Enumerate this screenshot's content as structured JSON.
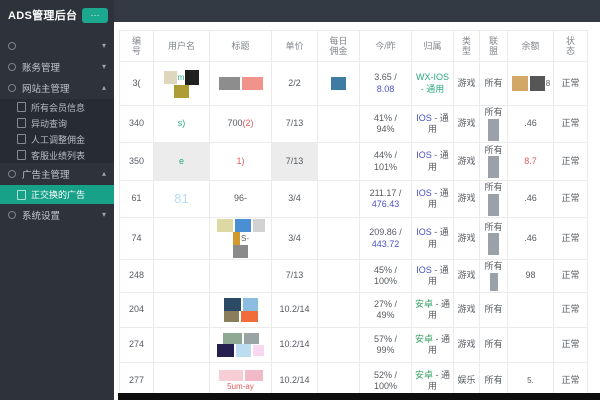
{
  "app": {
    "title": "ADS管理后台",
    "menu_button": "···"
  },
  "colors": {
    "accent_teal": "#1ba88e",
    "active_item": "#17a189",
    "link_blue": "#4b50c8",
    "green": "#2f9e5f",
    "teal_text": "#2aa87e",
    "red": "#e25a5a",
    "sidebar_bg": "#2d323b",
    "topbar_bg": "#343a44"
  },
  "sidebar": {
    "items": [
      {
        "type": "parent",
        "label": "",
        "caret": "down"
      },
      {
        "type": "parent",
        "label": "账务管理",
        "caret": "down"
      },
      {
        "type": "parent",
        "label": "网站主管理",
        "caret": "up"
      },
      {
        "type": "child",
        "label": "所有会员信息"
      },
      {
        "type": "child",
        "label": "异动查询"
      },
      {
        "type": "child",
        "label": "人工调整佣金"
      },
      {
        "type": "child",
        "label": "客服业绩列表"
      },
      {
        "type": "parent",
        "label": "广告主管理",
        "caret": "up"
      },
      {
        "type": "child",
        "label": "正交换的广告",
        "active": true
      },
      {
        "type": "parent",
        "label": "系统设置",
        "caret": "down"
      }
    ]
  },
  "table": {
    "columns": [
      {
        "label": "编\n号",
        "w": 34
      },
      {
        "label": "用户名",
        "w": 56
      },
      {
        "label": "标题",
        "w": 62
      },
      {
        "label": "单价",
        "w": 46
      },
      {
        "label": "每日\n佣金",
        "w": 42
      },
      {
        "label": "今/昨",
        "w": 52
      },
      {
        "label": "归属",
        "w": 42
      },
      {
        "label": "类\n型",
        "w": 26
      },
      {
        "label": "联\n盟",
        "w": 28
      },
      {
        "label": "余额",
        "w": 46
      },
      {
        "label": "状\n态",
        "w": 34
      }
    ],
    "rows": [
      {
        "h": 44,
        "cells": [
          {
            "seq": [
              {
                "t": "3("
              }
            ]
          },
          {
            "seq": [
              {
                "b": "#ded7bd",
                "w": 13,
                "h": 13
              },
              {
                "t": "m",
                "c": "#2aa87e",
                "s": 8
              },
              {
                "b": "#20201e",
                "w": 14,
                "h": 15
              },
              {
                "b": "#ac9e35",
                "w": 15,
                "h": 13
              }
            ]
          },
          {
            "seq": [
              {
                "b": "#8d8d8d",
                "w": 21,
                "h": 13
              },
              {
                "b": "#f0938a",
                "w": 21,
                "h": 13
              }
            ]
          },
          {
            "seq": [
              {
                "t": "2/2"
              }
            ]
          },
          {
            "seq": [
              {
                "b": "#3e7ca3",
                "w": 15,
                "h": 13
              }
            ]
          },
          {
            "seq": [
              {
                "t": "3.65 /"
              },
              {
                "br": true
              },
              {
                "t": "8.08",
                "c": "#4b50c8"
              }
            ]
          },
          {
            "seq": [
              {
                "t": "WX-IOS - 通用",
                "c": "#2aa87e"
              }
            ]
          },
          {
            "seq": [
              {
                "t": "游戏"
              }
            ]
          },
          {
            "seq": [
              {
                "t": "所有"
              }
            ]
          },
          {
            "seq": [
              {
                "b": "#d2a768",
                "w": 16,
                "h": 15
              },
              {
                "b": "#565656",
                "w": 15,
                "h": 15
              },
              {
                "t": "8",
                "s": 8
              }
            ]
          },
          {
            "seq": [
              {
                "t": "正常"
              }
            ]
          }
        ]
      },
      {
        "h": 37,
        "cells": [
          {
            "seq": [
              {
                "t": "340"
              }
            ]
          },
          {
            "seq": [
              {
                "t": "s)",
                "c": "#2aa87e"
              }
            ]
          },
          {
            "seq": [
              {
                "t": "700"
              },
              {
                "t": "(2)",
                "c": "#e25a5a"
              }
            ]
          },
          {
            "seq": [
              {
                "t": "7/13"
              }
            ]
          },
          {
            "seq": []
          },
          {
            "seq": [
              {
                "t": "41% /"
              },
              {
                "br": true
              },
              {
                "t": "94%"
              }
            ]
          },
          {
            "seq": [
              {
                "t": "IOS ",
                "c": "#4b50c8"
              },
              {
                "t": "- 通用"
              }
            ]
          },
          {
            "seq": [
              {
                "t": "游戏"
              }
            ]
          },
          {
            "seq": [
              {
                "t": "所有"
              },
              {
                "b": "#9aa1a9",
                "w": 11,
                "h": 22
              }
            ]
          },
          {
            "seq": [
              {
                "t": ".46"
              }
            ]
          },
          {
            "seq": [
              {
                "t": "正常"
              }
            ]
          }
        ]
      },
      {
        "h": 38,
        "cells": [
          {
            "seq": [
              {
                "t": "350"
              }
            ]
          },
          {
            "bg": "#ececec",
            "seq": [
              {
                "t": "e",
                "c": "#2aa87e"
              }
            ]
          },
          {
            "seq": [
              {
                "t": "1)",
                "c": "#e25a5a"
              }
            ]
          },
          {
            "bg": "#ececec",
            "seq": [
              {
                "t": "7/13"
              }
            ]
          },
          {
            "seq": []
          },
          {
            "seq": [
              {
                "t": "44% /"
              },
              {
                "br": true
              },
              {
                "t": "101%"
              }
            ]
          },
          {
            "seq": [
              {
                "t": "IOS ",
                "c": "#4b50c8"
              },
              {
                "t": "- 通用"
              }
            ]
          },
          {
            "seq": [
              {
                "t": "游戏"
              }
            ]
          },
          {
            "seq": [
              {
                "t": "所有"
              },
              {
                "b": "#9aa1a9",
                "w": 11,
                "h": 22
              }
            ]
          },
          {
            "seq": [
              {
                "t": "8.7",
                "c": "#e25a5a"
              }
            ]
          },
          {
            "seq": [
              {
                "t": "正常"
              }
            ]
          }
        ]
      },
      {
        "h": 37,
        "cells": [
          {
            "seq": [
              {
                "t": "61"
              }
            ]
          },
          {
            "seq": [
              {
                "t": "81",
                "c": "#b9ddf1",
                "s": 13
              }
            ]
          },
          {
            "seq": [
              {
                "t": "96-"
              }
            ]
          },
          {
            "seq": [
              {
                "t": "3/4"
              }
            ]
          },
          {
            "seq": []
          },
          {
            "seq": [
              {
                "t": "211.17 /"
              },
              {
                "br": true
              },
              {
                "t": "476.43",
                "c": "#4b50c8"
              }
            ]
          },
          {
            "seq": [
              {
                "t": "IOS ",
                "c": "#4b50c8"
              },
              {
                "t": "- 通用"
              }
            ]
          },
          {
            "seq": [
              {
                "t": "游戏"
              }
            ]
          },
          {
            "seq": [
              {
                "t": "所有"
              },
              {
                "b": "#9aa1a9",
                "w": 11,
                "h": 22
              }
            ]
          },
          {
            "seq": [
              {
                "t": ".46"
              }
            ]
          },
          {
            "seq": [
              {
                "t": "正常"
              }
            ]
          }
        ]
      },
      {
        "h": 38,
        "cells": [
          {
            "seq": [
              {
                "t": "74"
              }
            ]
          },
          {
            "seq": []
          },
          {
            "seq": [
              {
                "b": "#ded9a4",
                "w": 16,
                "h": 13
              },
              {
                "b": "#4a8fd4",
                "w": 16,
                "h": 13
              },
              {
                "b": "#d2d2d2",
                "w": 12,
                "h": 13
              },
              {
                "b": "#d1992e",
                "w": 7,
                "h": 13
              },
              {
                "t": "S-",
                "s": 8
              },
              {
                "br": true
              },
              {
                "b": "#8a8a8a",
                "w": 15,
                "h": 13
              }
            ]
          },
          {
            "seq": [
              {
                "t": "3/4"
              }
            ]
          },
          {
            "seq": []
          },
          {
            "seq": [
              {
                "t": "209.86 /"
              },
              {
                "br": true
              },
              {
                "t": "443.72",
                "c": "#4b50c8"
              }
            ]
          },
          {
            "seq": [
              {
                "t": "IOS ",
                "c": "#4b50c8"
              },
              {
                "t": "- 通用"
              }
            ]
          },
          {
            "seq": [
              {
                "t": "游戏"
              }
            ]
          },
          {
            "seq": [
              {
                "t": "所有"
              },
              {
                "b": "#9aa1a9",
                "w": 11,
                "h": 22
              }
            ]
          },
          {
            "seq": [
              {
                "t": ".46"
              }
            ]
          },
          {
            "seq": [
              {
                "t": "正常"
              }
            ]
          }
        ]
      },
      {
        "h": 33,
        "cells": [
          {
            "seq": [
              {
                "t": "248"
              }
            ]
          },
          {
            "seq": []
          },
          {
            "seq": []
          },
          {
            "seq": [
              {
                "t": "7/13"
              }
            ]
          },
          {
            "seq": []
          },
          {
            "seq": [
              {
                "t": "45% /"
              },
              {
                "br": true
              },
              {
                "t": "100%"
              }
            ]
          },
          {
            "seq": [
              {
                "t": "IOS ",
                "c": "#4b50c8"
              },
              {
                "t": "- 通用"
              }
            ]
          },
          {
            "seq": [
              {
                "t": "游戏"
              }
            ]
          },
          {
            "seq": [
              {
                "t": "所有"
              },
              {
                "b": "#9aa1a9",
                "w": 8,
                "h": 18
              }
            ]
          },
          {
            "seq": [
              {
                "t": "98"
              }
            ]
          },
          {
            "seq": [
              {
                "t": "正常"
              }
            ]
          }
        ]
      },
      {
        "h": 35,
        "cells": [
          {
            "seq": [
              {
                "t": "204"
              }
            ]
          },
          {
            "seq": []
          },
          {
            "seq": [
              {
                "b": "#2c4a66",
                "w": 17,
                "h": 13
              },
              {
                "b": "#8cbce0",
                "w": 15,
                "h": 13
              },
              {
                "br": true
              },
              {
                "b": "#8a7d5a",
                "w": 15,
                "h": 11
              },
              {
                "b": "#f26b3a",
                "w": 17,
                "h": 11
              }
            ]
          },
          {
            "seq": [
              {
                "t": "10.2/14"
              }
            ]
          },
          {
            "seq": []
          },
          {
            "seq": [
              {
                "t": "27% /"
              },
              {
                "br": true
              },
              {
                "t": "49%"
              }
            ]
          },
          {
            "seq": [
              {
                "t": "安卓 ",
                "c": "#2f9e5f"
              },
              {
                "t": "- 通用"
              }
            ]
          },
          {
            "seq": [
              {
                "t": "游戏"
              }
            ]
          },
          {
            "seq": [
              {
                "t": "所有"
              }
            ]
          },
          {
            "seq": []
          },
          {
            "seq": [
              {
                "t": "正常"
              }
            ]
          }
        ]
      },
      {
        "h": 35,
        "cells": [
          {
            "seq": [
              {
                "t": "274"
              }
            ]
          },
          {
            "seq": []
          },
          {
            "seq": [
              {
                "b": "#8fa894",
                "w": 19,
                "h": 11
              },
              {
                "b": "#9aa4a4",
                "w": 15,
                "h": 11
              },
              {
                "br": true
              },
              {
                "b": "#241f4e",
                "w": 17,
                "h": 13
              },
              {
                "b": "#bcdcf0",
                "w": 15,
                "h": 13
              },
              {
                "b": "#f8d8f0",
                "w": 11,
                "h": 11
              }
            ]
          },
          {
            "seq": [
              {
                "t": "10.2/14"
              }
            ]
          },
          {
            "seq": []
          },
          {
            "seq": [
              {
                "t": "57% /"
              },
              {
                "br": true
              },
              {
                "t": "99%"
              }
            ]
          },
          {
            "seq": [
              {
                "t": "安卓 ",
                "c": "#2f9e5f"
              },
              {
                "t": "- 通用"
              }
            ]
          },
          {
            "seq": [
              {
                "t": "游戏"
              }
            ]
          },
          {
            "seq": [
              {
                "t": "所有"
              }
            ]
          },
          {
            "seq": []
          },
          {
            "seq": [
              {
                "t": "正常"
              }
            ]
          }
        ]
      },
      {
        "h": 37,
        "cells": [
          {
            "seq": [
              {
                "t": "277"
              }
            ]
          },
          {
            "seq": []
          },
          {
            "seq": [
              {
                "b": "#f7cdd6",
                "w": 24,
                "h": 11
              },
              {
                "b": "#f2b9c6",
                "w": 18,
                "h": 11
              },
              {
                "br": true
              },
              {
                "t": "5um-ay",
                "c": "#e25a5a",
                "s": 8
              }
            ]
          },
          {
            "seq": [
              {
                "t": "10.2/14"
              }
            ]
          },
          {
            "seq": []
          },
          {
            "seq": [
              {
                "t": "52% /"
              },
              {
                "br": true
              },
              {
                "t": "100%"
              }
            ]
          },
          {
            "seq": [
              {
                "t": "安卓 ",
                "c": "#2f9e5f"
              },
              {
                "t": "- 通用"
              }
            ]
          },
          {
            "seq": [
              {
                "t": "娱乐"
              }
            ]
          },
          {
            "seq": [
              {
                "t": "所有"
              }
            ]
          },
          {
            "seq": [
              {
                "t": "5.",
                "s": 8
              }
            ]
          },
          {
            "seq": [
              {
                "t": "正常"
              }
            ]
          }
        ]
      }
    ]
  }
}
